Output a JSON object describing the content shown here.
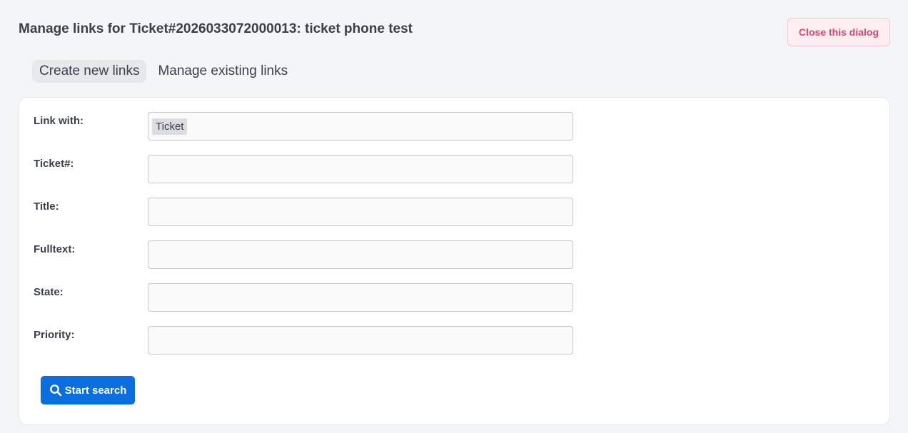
{
  "dialog": {
    "title": "Manage links for Ticket#2026033072000013: ticket phone test",
    "close_label": "Close this dialog"
  },
  "tabs": [
    {
      "label": "Create new links",
      "active": true
    },
    {
      "label": "Manage existing links",
      "active": false
    }
  ],
  "form": {
    "link_with": {
      "label": "Link with:",
      "value": "Ticket"
    },
    "ticket_number": {
      "label": "Ticket#:",
      "value": ""
    },
    "title": {
      "label": "Title:",
      "value": ""
    },
    "fulltext": {
      "label": "Fulltext:",
      "value": ""
    },
    "state": {
      "label": "State:",
      "value": ""
    },
    "priority": {
      "label": "Priority:",
      "value": ""
    }
  },
  "search_button": {
    "label": "Start search",
    "icon": "search-icon"
  },
  "colors": {
    "accent": "#0a6ee0",
    "close_text": "#e8426a",
    "close_bg": "#fdeef2"
  }
}
